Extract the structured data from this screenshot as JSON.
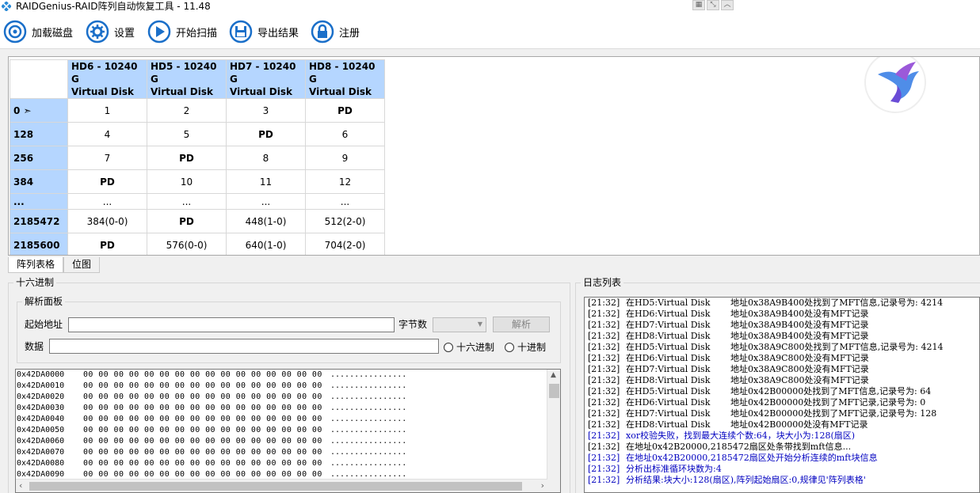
{
  "window": {
    "title": "RAIDGenius-RAID阵列自动恢复工具 - 11.48",
    "ctrl_icons": [
      "grid-icon",
      "restore-icon",
      "collapse-icon"
    ]
  },
  "toolbar": {
    "load_disk": "加载磁盘",
    "settings": "设置",
    "start_scan": "开始扫描",
    "export": "导出结果",
    "register": "注册"
  },
  "table": {
    "columns": [
      {
        "line1": "HD6 - 10240 G",
        "line2": "Virtual Disk"
      },
      {
        "line1": "HD5 - 10240 G",
        "line2": "Virtual Disk"
      },
      {
        "line1": "HD7 - 10240 G",
        "line2": "Virtual Disk"
      },
      {
        "line1": "HD8 - 10240 G",
        "line2": "Virtual Disk"
      }
    ],
    "rows": [
      {
        "head": "0 ➣",
        "cells": [
          "1",
          "2",
          "3",
          "PD"
        ]
      },
      {
        "head": "128",
        "cells": [
          "4",
          "5",
          "PD",
          "6"
        ]
      },
      {
        "head": "256",
        "cells": [
          "7",
          "PD",
          "8",
          "9"
        ]
      },
      {
        "head": "384",
        "cells": [
          "PD",
          "10",
          "11",
          "12"
        ]
      },
      {
        "head": "...",
        "cells": [
          "...",
          "...",
          "...",
          "..."
        ]
      },
      {
        "head": "2185472",
        "cells": [
          "384(0-0)",
          "PD",
          "448(1-0)",
          "512(2-0)"
        ]
      },
      {
        "head": "2185600",
        "cells": [
          "PD",
          "576(0-0)",
          "640(1-0)",
          "704(2-0)"
        ]
      }
    ]
  },
  "tabs": [
    {
      "label": "阵列表格",
      "active": true
    },
    {
      "label": "位图",
      "active": false
    }
  ],
  "hex_group": {
    "title": "十六进制",
    "panel_title": "解析面板",
    "start_addr_label": "起始地址",
    "start_addr_value": "",
    "bytes_label": "字节数",
    "bytes_value": "",
    "parse_button": "解析",
    "data_label": "数据",
    "data_value": "",
    "radio_hex": "十六进制",
    "radio_dec": "十进制"
  },
  "hex_lines": [
    {
      "addr": "0x42DA0000",
      "bytes": "00 00 00 00 00 00 00 00 00 00 00 00 00 00 00 00",
      "ascii": "................"
    },
    {
      "addr": "0x42DA0010",
      "bytes": "00 00 00 00 00 00 00 00 00 00 00 00 00 00 00 00",
      "ascii": "................"
    },
    {
      "addr": "0x42DA0020",
      "bytes": "00 00 00 00 00 00 00 00 00 00 00 00 00 00 00 00",
      "ascii": "................"
    },
    {
      "addr": "0x42DA0030",
      "bytes": "00 00 00 00 00 00 00 00 00 00 00 00 00 00 00 00",
      "ascii": "................"
    },
    {
      "addr": "0x42DA0040",
      "bytes": "00 00 00 00 00 00 00 00 00 00 00 00 00 00 00 00",
      "ascii": "................"
    },
    {
      "addr": "0x42DA0050",
      "bytes": "00 00 00 00 00 00 00 00 00 00 00 00 00 00 00 00",
      "ascii": "................"
    },
    {
      "addr": "0x42DA0060",
      "bytes": "00 00 00 00 00 00 00 00 00 00 00 00 00 00 00 00",
      "ascii": "................"
    },
    {
      "addr": "0x42DA0070",
      "bytes": "00 00 00 00 00 00 00 00 00 00 00 00 00 00 00 00",
      "ascii": "................"
    },
    {
      "addr": "0x42DA0080",
      "bytes": "00 00 00 00 00 00 00 00 00 00 00 00 00 00 00 00",
      "ascii": "................"
    },
    {
      "addr": "0x42DA0090",
      "bytes": "00 00 00 00 00 00 00 00 00 00 00 00 00 00 00 00",
      "ascii": "................"
    }
  ],
  "log": {
    "title": "日志列表",
    "lines": [
      {
        "ts": "[21:32]",
        "disk": "在HD5:Virtual Disk",
        "msg": "地址0x38A9B400处找到了MFT信息,记录号为: 4214",
        "blue": false
      },
      {
        "ts": "[21:32]",
        "disk": "在HD6:Virtual Disk",
        "msg": "地址0x38A9B400处没有MFT记录",
        "blue": false
      },
      {
        "ts": "[21:32]",
        "disk": "在HD7:Virtual Disk",
        "msg": "地址0x38A9B400处没有MFT记录",
        "blue": false
      },
      {
        "ts": "[21:32]",
        "disk": "在HD8:Virtual Disk",
        "msg": "地址0x38A9B400处没有MFT记录",
        "blue": false
      },
      {
        "ts": "[21:32]",
        "disk": "在HD5:Virtual Disk",
        "msg": "地址0x38A9C800处找到了MFT信息,记录号为: 4214",
        "blue": false
      },
      {
        "ts": "[21:32]",
        "disk": "在HD6:Virtual Disk",
        "msg": "地址0x38A9C800处没有MFT记录",
        "blue": false
      },
      {
        "ts": "[21:32]",
        "disk": "在HD7:Virtual Disk",
        "msg": "地址0x38A9C800处没有MFT记录",
        "blue": false
      },
      {
        "ts": "[21:32]",
        "disk": "在HD8:Virtual Disk",
        "msg": "地址0x38A9C800处没有MFT记录",
        "blue": false
      },
      {
        "ts": "[21:32]",
        "disk": "在HD5:Virtual Disk",
        "msg": "地址0x42B00000处找到了MFT信息,记录号为: 64",
        "blue": false
      },
      {
        "ts": "[21:32]",
        "disk": "在HD6:Virtual Disk",
        "msg": "地址0x42B00000处找到了MFT记录,记录号为: 0",
        "blue": false
      },
      {
        "ts": "[21:32]",
        "disk": "在HD7:Virtual Disk",
        "msg": "地址0x42B00000处找到了MFT记录,记录号为: 128",
        "blue": false
      },
      {
        "ts": "[21:32]",
        "disk": "在HD8:Virtual Disk",
        "msg": "地址0x42B00000处没有MFT记录",
        "blue": false
      },
      {
        "ts": "[21:32]",
        "disk": "xor校验失败，找到最大连续个数:64，块大小为:128(扇区)",
        "msg": "",
        "blue": true
      },
      {
        "ts": "[21:32]",
        "disk": "在地址0x42B20000,2185472扇区处条带找到mft信息...",
        "msg": "",
        "blue": false
      },
      {
        "ts": "[21:32]",
        "disk": "在地址0x42B20000,2185472扇区处开始分析连续的mft块信息",
        "msg": "",
        "blue": true
      },
      {
        "ts": "[21:32]",
        "disk": "分析出标准循环块数为:4",
        "msg": "",
        "blue": true
      },
      {
        "ts": "[21:32]",
        "disk": "分析结果:块大小:128(扇区),阵列起始扇区:0,规律见'阵列表格'",
        "msg": "",
        "blue": true
      }
    ]
  },
  "colors": {
    "header_bg": "#b5d6ff",
    "toolbar_icon": "#1a6fc9",
    "log_blue": "#0000c0"
  }
}
